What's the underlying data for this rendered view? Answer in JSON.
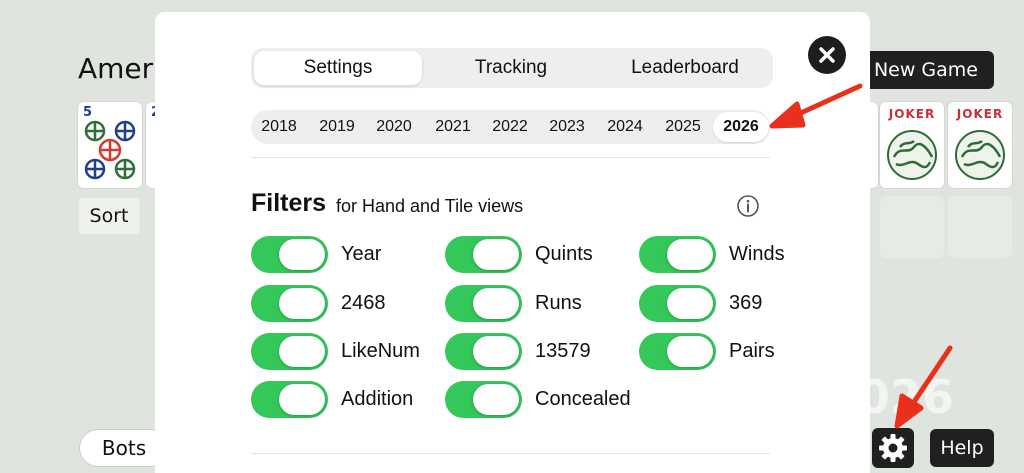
{
  "background": {
    "title": "Amer",
    "tile_number": "5",
    "tile_number_2": "2",
    "joker_label": "JOKER",
    "sort_label": "Sort",
    "bots_label": "Bots",
    "new_game_label": "New Game",
    "help_label": "Help",
    "ghost_year": "026"
  },
  "modal": {
    "tabs": [
      {
        "label": "Settings",
        "active": true
      },
      {
        "label": "Tracking",
        "active": false
      },
      {
        "label": "Leaderboard",
        "active": false
      }
    ],
    "years": [
      "2018",
      "2019",
      "2020",
      "2021",
      "2022",
      "2023",
      "2024",
      "2025",
      "2026"
    ],
    "selected_year": "2026",
    "filters": {
      "title": "Filters",
      "subtitle": "for Hand and Tile views",
      "toggles": [
        {
          "label": "Year",
          "on": true
        },
        {
          "label": "Quints",
          "on": true
        },
        {
          "label": "Winds",
          "on": true
        },
        {
          "label": "2468",
          "on": true
        },
        {
          "label": "Runs",
          "on": true
        },
        {
          "label": "369",
          "on": true
        },
        {
          "label": "LikeNum",
          "on": true
        },
        {
          "label": "13579",
          "on": true
        },
        {
          "label": "Pairs",
          "on": true
        },
        {
          "label": "Addition",
          "on": true
        },
        {
          "label": "Concealed",
          "on": true
        }
      ]
    }
  },
  "colors": {
    "toggle_on": "#34c759",
    "annotation_arrow": "#e8301c",
    "button_dark": "#202020",
    "page_background": "#dfe5de"
  }
}
